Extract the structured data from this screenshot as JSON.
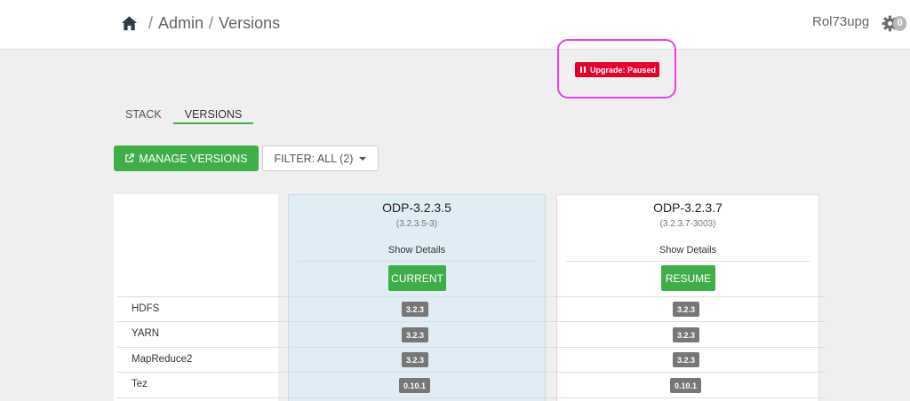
{
  "breadcrumb": {
    "root": "Admin",
    "current": "Versions",
    "separator": "/"
  },
  "header": {
    "user": "Rol73upg",
    "alert_count": "0"
  },
  "upgrade_status": {
    "label": "Upgrade: Paused",
    "color": "#e8002d"
  },
  "tabs": [
    {
      "label": "STACK",
      "active": false
    },
    {
      "label": "VERSIONS",
      "active": true
    }
  ],
  "actions": {
    "manage_label": "MANAGE VERSIONS",
    "filter_label": "FILTER: ALL (2)"
  },
  "versions": [
    {
      "name": "ODP-3.2.3.5",
      "build": "(3.2.3.5-3)",
      "details": "Show Details",
      "action": "CURRENT"
    },
    {
      "name": "ODP-3.2.3.7",
      "build": "(3.2.3.7-3003)",
      "details": "Show Details",
      "action": "RESUME"
    }
  ],
  "services": [
    {
      "name": "HDFS",
      "v1": "3.2.3",
      "v2": "3.2.3"
    },
    {
      "name": "YARN",
      "v1": "3.2.3",
      "v2": "3.2.3"
    },
    {
      "name": "MapReduce2",
      "v1": "3.2.3",
      "v2": "3.2.3"
    },
    {
      "name": "Tez",
      "v1": "0.10.1",
      "v2": "0.10.1"
    }
  ],
  "colors": {
    "accent": "#3fae49",
    "highlight": "#e83fe8",
    "badge": "#777777"
  }
}
